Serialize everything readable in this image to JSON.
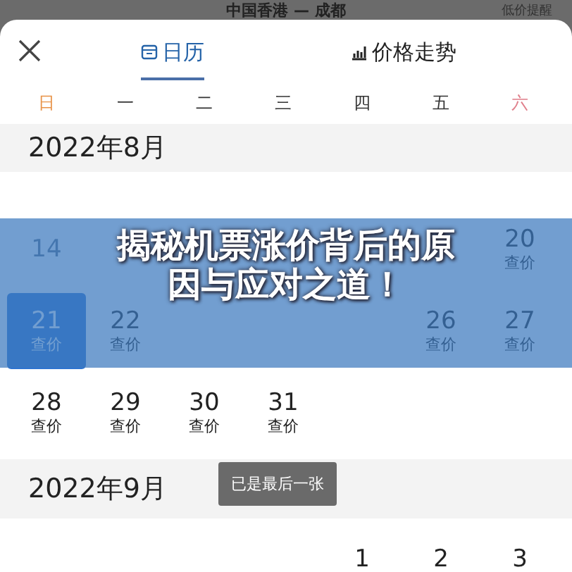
{
  "background_header": {
    "title": "中国香港 — 成都",
    "action": "低价提醒"
  },
  "tabs": [
    {
      "label": "日历",
      "selected": true
    },
    {
      "label": "价格走势",
      "selected": false
    }
  ],
  "weekdays": [
    {
      "label": "日",
      "color": "#e8944a"
    },
    {
      "label": "一",
      "color": "#333333"
    },
    {
      "label": "二",
      "color": "#333333"
    },
    {
      "label": "三",
      "color": "#333333"
    },
    {
      "label": "四",
      "color": "#333333"
    },
    {
      "label": "五",
      "color": "#333333"
    },
    {
      "label": "六",
      "color": "#e0808c"
    }
  ],
  "months": [
    {
      "title": "2022年8月",
      "weeks": [
        [
          {
            "kind": "day",
            "day": "14",
            "disabled": true,
            "selected": false
          },
          {
            "kind": "blank"
          },
          {
            "kind": "blank"
          },
          {
            "kind": "blank"
          },
          {
            "kind": "blank"
          },
          {
            "kind": "blank"
          },
          {
            "kind": "day",
            "day": "20",
            "price": "查价",
            "disabled": false,
            "selected": false
          }
        ],
        [
          {
            "kind": "day",
            "day": "21",
            "price": "查价",
            "disabled": false,
            "selected": true
          },
          {
            "kind": "day",
            "day": "22",
            "price": "查价",
            "disabled": false,
            "selected": false
          },
          {
            "kind": "blank"
          },
          {
            "kind": "blank"
          },
          {
            "kind": "blank"
          },
          {
            "kind": "day",
            "day": "26",
            "price": "查价",
            "disabled": false,
            "selected": false
          },
          {
            "kind": "day",
            "day": "27",
            "price": "查价",
            "disabled": false,
            "selected": false
          }
        ],
        [
          {
            "kind": "day",
            "day": "28",
            "price": "查价",
            "disabled": false,
            "selected": false
          },
          {
            "kind": "day",
            "day": "29",
            "price": "查价",
            "disabled": false,
            "selected": false
          },
          {
            "kind": "day",
            "day": "30",
            "price": "查价",
            "disabled": false,
            "selected": false
          },
          {
            "kind": "day",
            "day": "31",
            "price": "查价",
            "disabled": false,
            "selected": false
          }
        ]
      ]
    },
    {
      "title": "2022年9月",
      "weeks": [
        [
          {
            "kind": "blank"
          },
          {
            "kind": "blank"
          },
          {
            "kind": "blank"
          },
          {
            "kind": "blank"
          },
          {
            "kind": "day",
            "day": "1",
            "disabled": false,
            "selected": false
          },
          {
            "kind": "day",
            "day": "2",
            "disabled": false,
            "selected": false
          },
          {
            "kind": "day",
            "day": "3",
            "disabled": false,
            "selected": false
          }
        ]
      ]
    }
  ],
  "overlay_title": "揭秘机票涨价背后的原因与应对之道！",
  "toast": "已是最后一张"
}
